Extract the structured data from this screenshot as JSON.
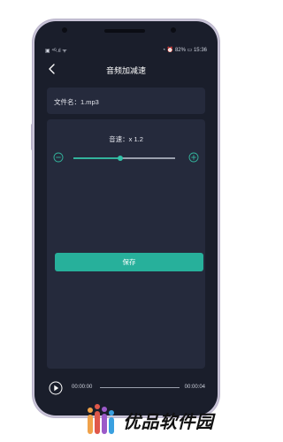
{
  "status_bar": {
    "left": "▣ ⁴ᴳ.ıl ᯤ",
    "right": "◔ ⏰ 82% ▭ 15:36"
  },
  "nav": {
    "title": "音频加减速",
    "back_icon": "chevron-left-icon"
  },
  "file": {
    "label": "文件名：1.mp3"
  },
  "speed": {
    "label": "音速：x 1.2",
    "level_fraction": 0.46
  },
  "actions": {
    "save_label": "保存"
  },
  "player": {
    "current_time": "00:00:00",
    "total_time": "00:00:04",
    "progress": 0
  },
  "branding": {
    "text": "优品软件园"
  },
  "colors": {
    "accent": "#27b09b",
    "background": "#1a1e2b",
    "card": "#252a3c"
  }
}
